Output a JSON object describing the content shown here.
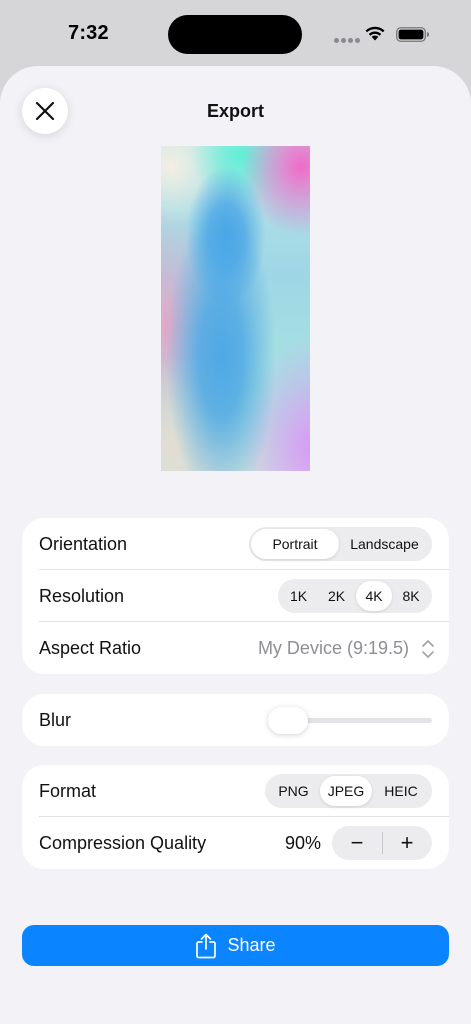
{
  "status_bar": {
    "time": "7:32"
  },
  "sheet": {
    "title": "Export"
  },
  "orientation": {
    "label": "Orientation",
    "options": [
      "Portrait",
      "Landscape"
    ],
    "selected": "Portrait"
  },
  "resolution": {
    "label": "Resolution",
    "options": [
      "1K",
      "2K",
      "4K",
      "8K"
    ],
    "selected": "4K"
  },
  "aspect_ratio": {
    "label": "Aspect Ratio",
    "value": "My Device (9:19.5)"
  },
  "blur": {
    "label": "Blur",
    "value": 0
  },
  "format": {
    "label": "Format",
    "options": [
      "PNG",
      "JPEG",
      "HEIC"
    ],
    "selected": "JPEG"
  },
  "compression": {
    "label": "Compression Quality",
    "value": "90%",
    "decrement": "−",
    "increment": "+"
  },
  "share": {
    "label": "Share"
  },
  "colors": {
    "accent": "#0a84ff",
    "sheet_background": "#f2f2f7",
    "card_background": "#ffffff",
    "secondary_text": "#8e8e93"
  },
  "icons": [
    "close-icon",
    "share-icon",
    "chevron-up-down-icon",
    "wifi-icon",
    "battery-icon",
    "cellular-icon"
  ]
}
